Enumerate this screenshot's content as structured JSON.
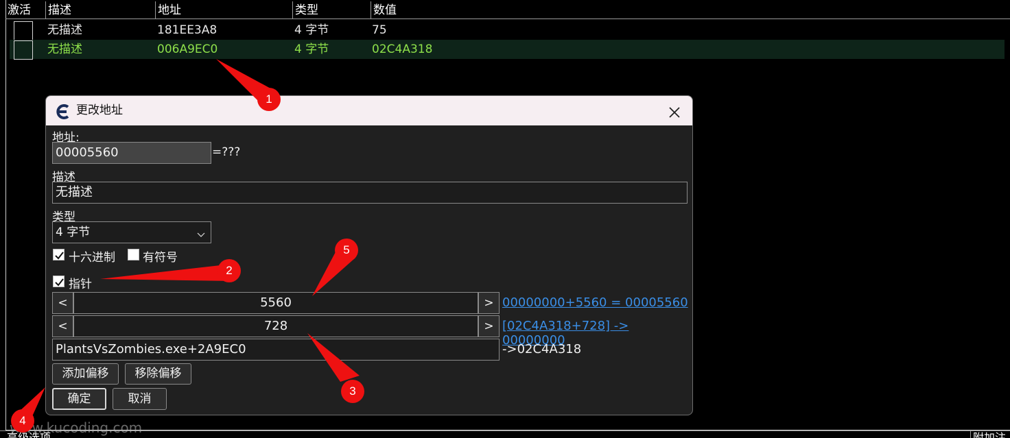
{
  "list": {
    "headers": [
      "激活",
      "描述",
      "地址",
      "类型",
      "数值"
    ],
    "rows": [
      {
        "desc": "无描述",
        "address": "181EE3A8",
        "type": "4 字节",
        "value": "75"
      },
      {
        "desc": "无描述",
        "address": "006A9EC0",
        "type": "4 字节",
        "value": "02C4A318"
      }
    ]
  },
  "dialog": {
    "title": "更改地址",
    "address_label": "地址:",
    "address_value": "00005560",
    "address_result": "=???",
    "desc_label": "描述",
    "desc_value": "无描述",
    "type_label": "类型",
    "type_value": "4 字节",
    "hex_label": "十六进制",
    "signed_label": "有符号",
    "pointer_label": "指针",
    "offsets": [
      {
        "value": "5560",
        "result": "00000000+5560 = 00005560"
      },
      {
        "value": "728",
        "result": "[02C4A318+728] -> 00000000"
      }
    ],
    "base_value": "PlantsVsZombies.exe+2A9EC0",
    "base_result": "->02C4A318",
    "add_offset": "添加偏移",
    "remove_offset": "移除偏移",
    "ok": "确定",
    "cancel": "取消",
    "nav_prev": "<",
    "nav_next": ">"
  },
  "annotations": [
    "1",
    "2",
    "3",
    "4",
    "5"
  ],
  "footer": {
    "left": "高级选项",
    "right": "附加注",
    "watermark": "www.kucoding.com"
  },
  "colors": {
    "annotation": "#ee1111",
    "highlight_row_text": "#8ee04a",
    "link": "#3a8ee6"
  }
}
